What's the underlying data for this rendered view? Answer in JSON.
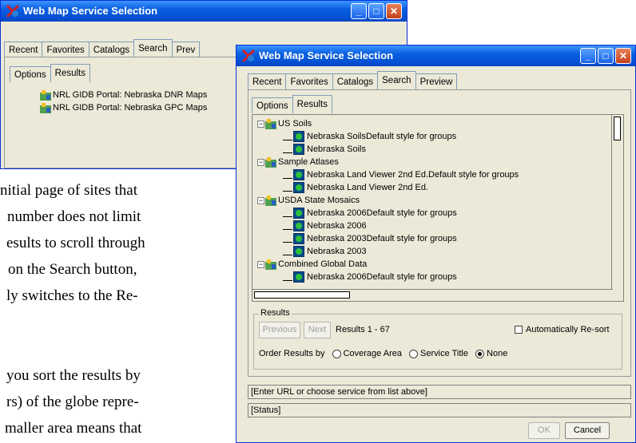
{
  "document": {
    "lines": [
      "nitial page of sites that",
      "number does not limit",
      "esults to scroll through",
      "on the Search button,",
      "ly switches to the Re-",
      "you sort the results by",
      "rs) of the globe repre-",
      "maller area means that"
    ]
  },
  "back_window": {
    "title": "Web Map Service Selection",
    "tabs": [
      "Recent",
      "Favorites",
      "Catalogs",
      "Search",
      "Prev"
    ],
    "subtabs": [
      "Options",
      "Results"
    ],
    "results": [
      "NRL GIDB Portal: Nebraska DNR Maps",
      "NRL GIDB Portal: Nebraska GPC Maps"
    ]
  },
  "front_window": {
    "title": "Web Map Service Selection",
    "tabs": [
      "Recent",
      "Favorites",
      "Catalogs",
      "Search",
      "Preview"
    ],
    "subtabs": [
      "Options",
      "Results"
    ],
    "tree": [
      {
        "type": "group",
        "label": "US Soils"
      },
      {
        "type": "leaf",
        "label": "Nebraska SoilsDefault style for groups"
      },
      {
        "type": "leaf",
        "label": "Nebraska Soils"
      },
      {
        "type": "group",
        "label": "Sample Atlases"
      },
      {
        "type": "leaf",
        "label": "Nebraska Land Viewer 2nd Ed.Default style for groups"
      },
      {
        "type": "leaf",
        "label": "Nebraska Land Viewer 2nd Ed."
      },
      {
        "type": "group",
        "label": "USDA State Mosaics"
      },
      {
        "type": "leaf",
        "label": "Nebraska 2006Default style for groups"
      },
      {
        "type": "leaf",
        "label": "Nebraska 2006"
      },
      {
        "type": "leaf",
        "label": "Nebraska  2003Default style for groups"
      },
      {
        "type": "leaf",
        "label": "Nebraska  2003"
      },
      {
        "type": "group",
        "label": "Combined Global Data"
      },
      {
        "type": "leaf",
        "label": "Nebraska 2006Default style for groups"
      }
    ],
    "results_group": {
      "legend": "Results",
      "previous_label": "Previous",
      "next_label": "Next",
      "range_text": "Results 1 - 67",
      "auto_resort_label": "Automatically Re-sort",
      "order_label": "Order Results by",
      "order_options": [
        "Coverage Area",
        "Service Title",
        "None"
      ],
      "order_selected": "None"
    },
    "url_field": "[Enter URL or choose service from list above]",
    "status_field": "[Status]",
    "ok_label": "OK",
    "cancel_label": "Cancel"
  },
  "colors": {
    "titlebar": "#0a5fe0",
    "window_bg": "#ece9d8"
  }
}
